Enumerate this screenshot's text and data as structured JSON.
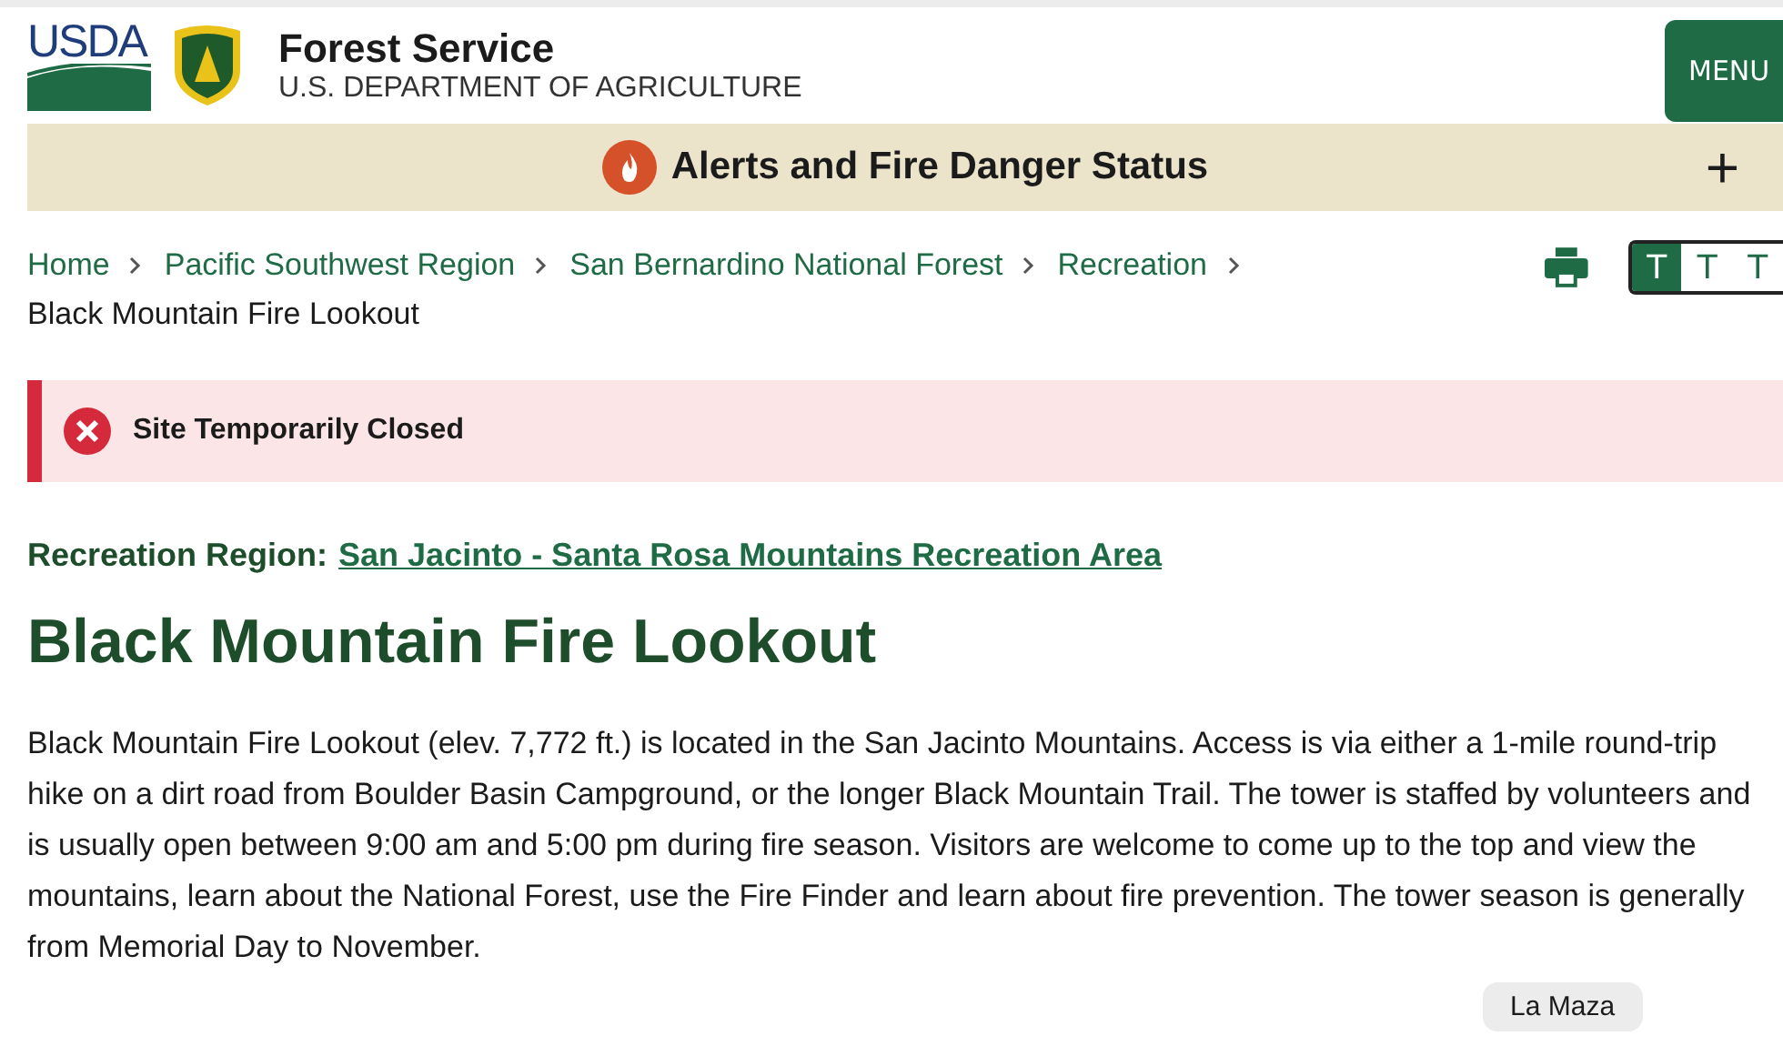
{
  "header": {
    "logo_text": "USDA",
    "title": "Forest Service",
    "subtitle": "U.S. DEPARTMENT OF AGRICULTURE",
    "menu_button": "MENU"
  },
  "alert_bar": {
    "label": "Alerts and Fire Danger Status",
    "toggle": "+"
  },
  "breadcrumbs": [
    {
      "label": "Home",
      "link": true
    },
    {
      "label": "Pacific Southwest Region",
      "link": true
    },
    {
      "label": "San Bernardino National Forest",
      "link": true
    },
    {
      "label": "Recreation",
      "link": true
    },
    {
      "label": "Black Mountain Fire Lookout",
      "link": false
    }
  ],
  "text_size": [
    {
      "label": "T",
      "selected": true
    },
    {
      "label": "T",
      "selected": false
    },
    {
      "label": "T",
      "selected": false
    }
  ],
  "notice": {
    "text": "Site Temporarily Closed"
  },
  "recreation_region": {
    "label": "Recreation Region:",
    "link": "San Jacinto - Santa Rosa Mountains Recreation Area"
  },
  "title": "Black Mountain Fire Lookout",
  "description": "Black Mountain Fire Lookout (elev. 7,772 ft.) is located in the San Jacinto Mountains. Access is via either a 1-mile round-trip hike on a dirt road from Boulder Basin Campground, or the longer Black Mountain Trail. The tower is staffed by volunteers and is usually open between 9:00 am and 5:00 pm during fire season. Visitors are welcome to come up to the top and view the mountains, learn about the National Forest, use the Fire Finder and learn about fire prevention. The tower season is generally from Memorial Day to November.",
  "tooltip": "La Maza"
}
